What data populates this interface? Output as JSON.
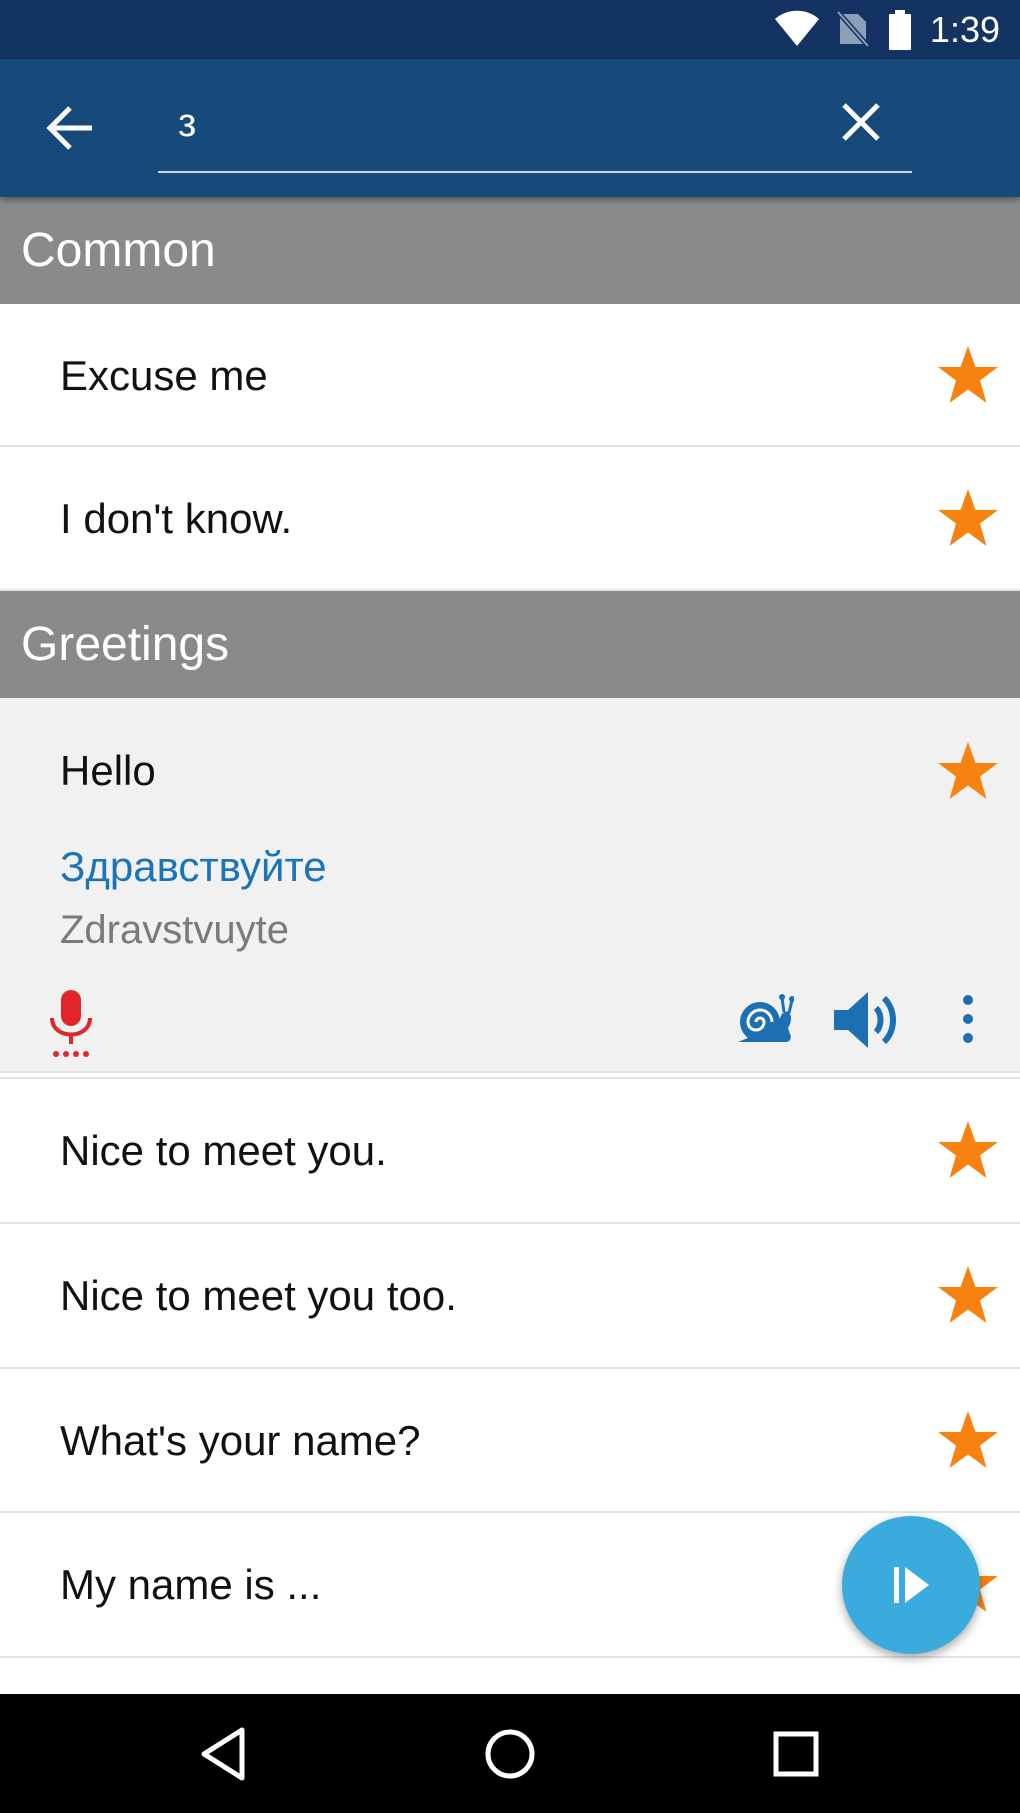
{
  "status_bar": {
    "time": "1:39",
    "icons": [
      "wifi-icon",
      "no-sim-icon",
      "battery-icon"
    ]
  },
  "app_bar": {
    "back_icon": "arrow-back-icon",
    "search_value": "з",
    "search_placeholder": "",
    "clear_icon": "close-icon"
  },
  "sections": [
    {
      "title": "Common",
      "items": [
        {
          "label": "Excuse me",
          "favorite": true
        },
        {
          "label": "I don't know.",
          "favorite": true
        }
      ]
    },
    {
      "title": "Greetings",
      "expanded_item": {
        "label": "Hello",
        "translation": "Здравствуйте",
        "transliteration": "Zdravstvuyte",
        "favorite": true,
        "actions": [
          "microphone-icon",
          "snail-slow-icon",
          "speaker-icon",
          "more-vert-icon"
        ]
      },
      "items": [
        {
          "label": "Nice to meet you.",
          "favorite": true
        },
        {
          "label": "Nice to meet you too.",
          "favorite": true
        },
        {
          "label": "What's your name?",
          "favorite": true
        },
        {
          "label": "My name is ...",
          "favorite": true
        }
      ]
    }
  ],
  "fab": {
    "icon": "play-icon"
  },
  "nav_bar": {
    "icons": [
      "nav-back-icon",
      "nav-home-icon",
      "nav-recents-icon"
    ]
  },
  "colors": {
    "status_bar": "#133463",
    "app_bar": "#154a7a",
    "section_header": "#8a8a8a",
    "star": "#f7820f",
    "translation": "#1b73b8",
    "mic": "#e0262b",
    "action_blue": "#1d6fb4",
    "fab": "#3aabdc"
  }
}
